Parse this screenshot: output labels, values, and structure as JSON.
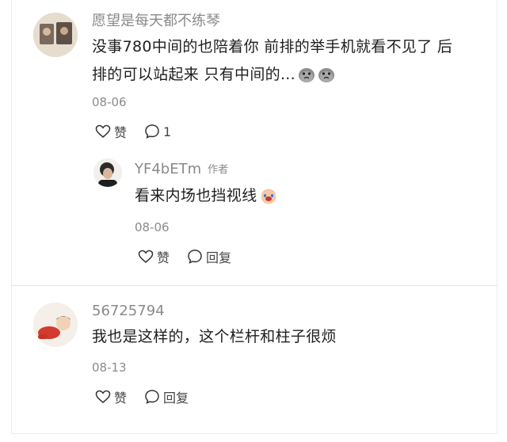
{
  "comments": [
    {
      "username": "愿望是每天都不练琴",
      "text_line1": "没事780中间的也陪着你 前排的举手机就看不见了 后",
      "text_line2": "排的可以站起来 只有中间的...",
      "date": "08-06",
      "like_label": "赞",
      "reply_count": "1"
    },
    {
      "username": "YF4bETm",
      "author_tag": "作者",
      "text": "看来内场也挡视线",
      "date": "08-06",
      "like_label": "赞",
      "reply_label": "回复"
    },
    {
      "username": "56725794",
      "text": "我也是这样的，这个栏杆和柱子很烦",
      "date": "08-13",
      "like_label": "赞",
      "reply_label": "回复"
    }
  ],
  "icons": [
    "heart-icon",
    "comment-bubble-icon",
    "crying-emoji-icon"
  ]
}
